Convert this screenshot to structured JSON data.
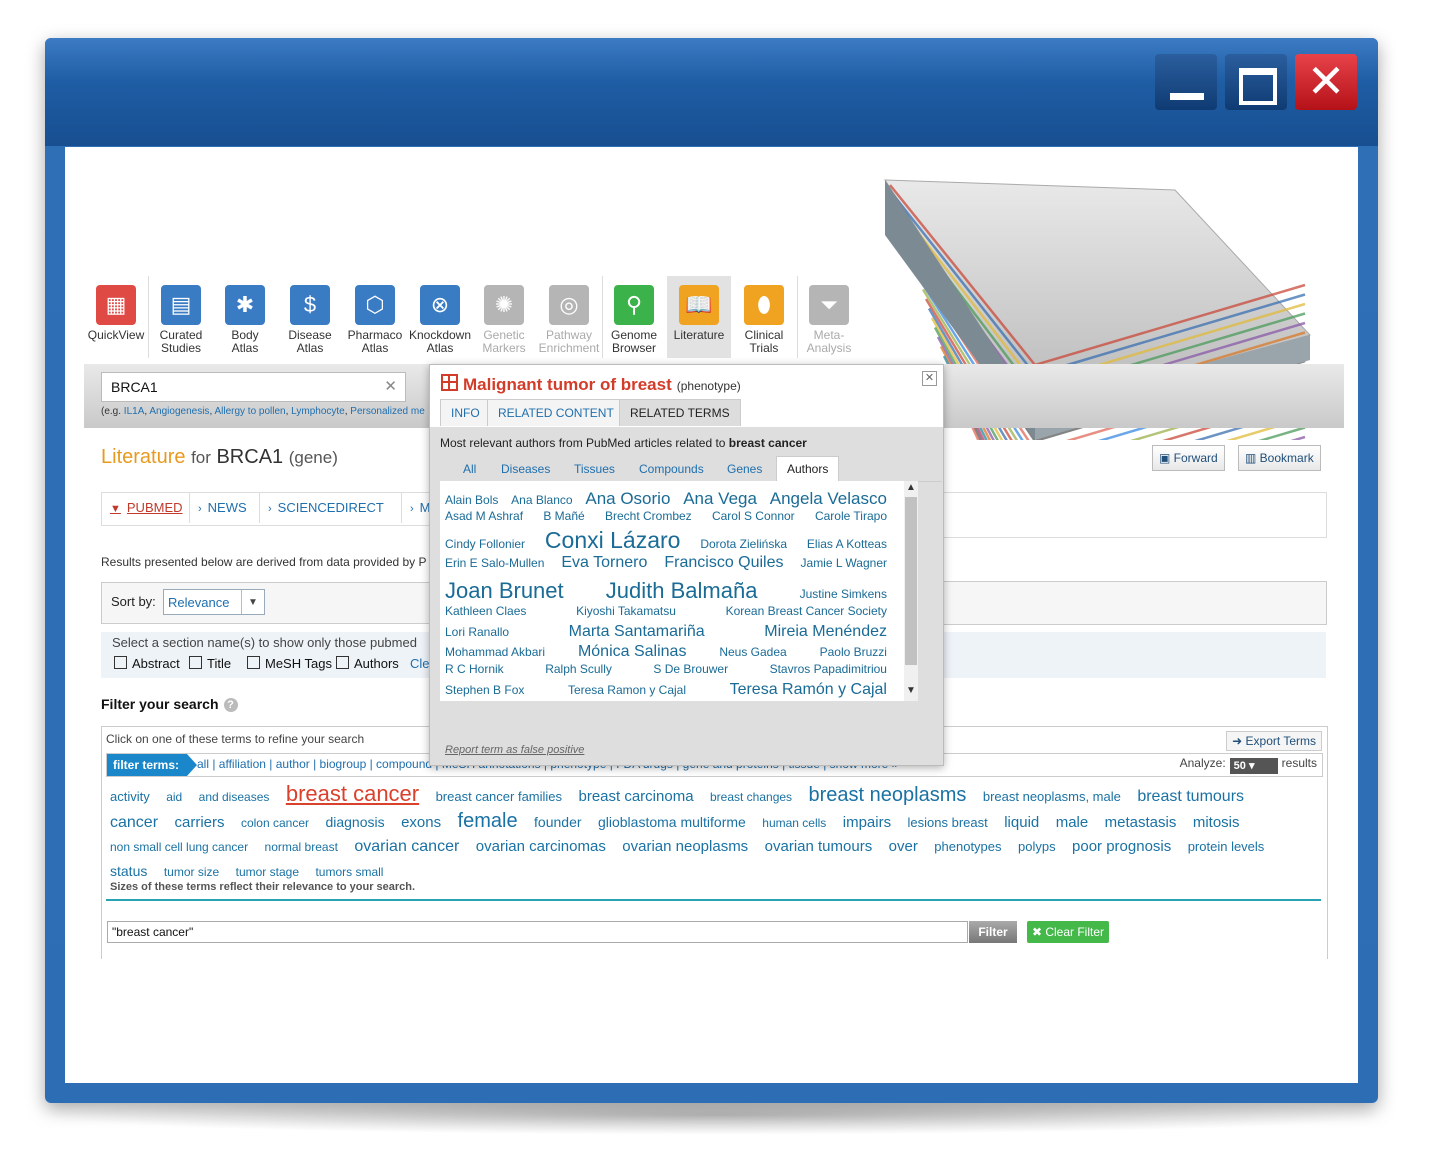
{
  "window": {
    "close_glyph": "✕"
  },
  "nav": [
    {
      "label1": "QuickView",
      "label2": "",
      "icon": "grid-icon",
      "glyph": "▦",
      "color": "#e04a45",
      "dim": false
    },
    {
      "label1": "Curated",
      "label2": "Studies",
      "icon": "folder-icon",
      "glyph": "▤",
      "color": "#3a7cc4",
      "dim": false
    },
    {
      "label1": "Body",
      "label2": "Atlas",
      "icon": "body-icon",
      "glyph": "✱",
      "color": "#3a7cc4",
      "dim": false
    },
    {
      "label1": "Disease",
      "label2": "Atlas",
      "icon": "dollar-icon",
      "glyph": "$",
      "color": "#3a7cc4",
      "dim": false
    },
    {
      "label1": "Pharmaco",
      "label2": "Atlas",
      "icon": "molecule-icon",
      "glyph": "⬡",
      "color": "#3a7cc4",
      "dim": false
    },
    {
      "label1": "Knockdown",
      "label2": "Atlas",
      "icon": "dna-icon",
      "glyph": "⊗",
      "color": "#3a7cc4",
      "dim": false
    },
    {
      "label1": "Genetic",
      "label2": "Markers",
      "icon": "virus-icon",
      "glyph": "✺",
      "color": "#b5b5b5",
      "dim": true
    },
    {
      "label1": "Pathway",
      "label2": "Enrichment",
      "icon": "circles-icon",
      "glyph": "◎",
      "color": "#b5b5b5",
      "dim": true
    },
    {
      "label1": "Genome",
      "label2": "Browser",
      "icon": "magnifier-dna-icon",
      "glyph": "⚲",
      "color": "#3bb34a",
      "dim": false
    },
    {
      "label1": "Literature",
      "label2": "",
      "icon": "book-icon",
      "glyph": "📖",
      "color": "#f0a321",
      "dim": false
    },
    {
      "label1": "Clinical",
      "label2": "Trials",
      "icon": "pill-icon",
      "glyph": "⬮",
      "color": "#f0a321",
      "dim": false
    },
    {
      "label1": "Meta-",
      "label2": "Analysis",
      "icon": "funnel-icon",
      "glyph": "⏷",
      "color": "#b5b5b5",
      "dim": true
    }
  ],
  "search": {
    "value": "BRCA1",
    "clear": "✕",
    "hint_prefix": "(e.g. ",
    "hint_links": [
      "IL1A",
      "Angiogenesis",
      "Allergy to pollen",
      "Lymphocyte",
      "Personalized me"
    ]
  },
  "main": {
    "title_lit": "Literature",
    "title_for": "for",
    "title_gene": "BRCA1",
    "title_type": "(gene)",
    "source_tabs": [
      "PUBMED",
      "NEWS",
      "SCIENCEDIRECT",
      "MA"
    ],
    "results_note": "Results presented below are derived from data provided by P",
    "sort_label": "Sort by:",
    "sort_value": "Relevance",
    "section_prompt": "Select a section name(s) to show only those pubmed",
    "section_checks": [
      "Abstract",
      "Title",
      "MeSH Tags",
      "Authors",
      "Cle"
    ],
    "forward": "Forward",
    "bookmark": "Bookmark"
  },
  "filter": {
    "title": "Filter your search",
    "hint": "Click on one of these terms to refine your search",
    "export": "Export Terms",
    "label": "filter terms:",
    "links": "all | affiliation | author | biogroup | compound | MeSH annotations | phenotype | FDA drugs | gene and proteins | tissue | show more »",
    "analyze_label": "Analyze:",
    "analyze_value": "50",
    "analyze_suffix": "results",
    "terms": [
      {
        "t": "activity",
        "s": 13
      },
      {
        "t": "aid",
        "s": 12
      },
      {
        "t": "and diseases",
        "s": 12
      },
      {
        "t": "breast cancer",
        "s": 22,
        "hot": true
      },
      {
        "t": "breast cancer families",
        "s": 13
      },
      {
        "t": "breast carcinoma",
        "s": 15
      },
      {
        "t": "breast changes",
        "s": 12
      },
      {
        "t": "breast neoplasms",
        "s": 20
      },
      {
        "t": "breast neoplasms, male",
        "s": 13
      },
      {
        "t": "breast tumours",
        "s": 16
      },
      {
        "t": "cancer",
        "s": 16
      },
      {
        "t": "carriers",
        "s": 15
      },
      {
        "t": "colon cancer",
        "s": 12
      },
      {
        "t": "diagnosis",
        "s": 14
      },
      {
        "t": "exons",
        "s": 15
      },
      {
        "t": "female",
        "s": 20
      },
      {
        "t": "founder",
        "s": 14
      },
      {
        "t": "glioblastoma multiforme",
        "s": 14
      },
      {
        "t": "human cells",
        "s": 12
      },
      {
        "t": "impairs",
        "s": 15
      },
      {
        "t": "lesions breast",
        "s": 13
      },
      {
        "t": "liquid",
        "s": 15
      },
      {
        "t": "male",
        "s": 15
      },
      {
        "t": "metastasis",
        "s": 15
      },
      {
        "t": "mitosis",
        "s": 15
      },
      {
        "t": "non small cell lung cancer",
        "s": 12
      },
      {
        "t": "normal breast",
        "s": 12
      },
      {
        "t": "ovarian cancer",
        "s": 16
      },
      {
        "t": "ovarian carcinomas",
        "s": 15
      },
      {
        "t": "ovarian neoplasms",
        "s": 15
      },
      {
        "t": "ovarian tumours",
        "s": 15
      },
      {
        "t": "over",
        "s": 15
      },
      {
        "t": "phenotypes",
        "s": 13
      },
      {
        "t": "polyps",
        "s": 13
      },
      {
        "t": "poor prognosis",
        "s": 15
      },
      {
        "t": "protein levels",
        "s": 13
      },
      {
        "t": "status",
        "s": 14
      },
      {
        "t": "tumor size",
        "s": 12
      },
      {
        "t": "tumor stage",
        "s": 12
      },
      {
        "t": "tumors small",
        "s": 12
      }
    ],
    "cloud_note": "Sizes of these terms reflect their relevance to your search.",
    "input_value": "\"breast cancer\"",
    "filter_btn": "Filter",
    "clear_btn": "✖ Clear Filter"
  },
  "popup": {
    "title": "Malignant tumor of breast",
    "type": "(phenotype)",
    "close": "✕",
    "tabs": [
      "INFO",
      "RELATED CONTENT",
      "RELATED TERMS"
    ],
    "sub_prefix": "Most relevant authors from PubMed articles related to ",
    "sub_term": "breast cancer",
    "author_tabs": [
      "All",
      "Diseases",
      "Tissues",
      "Compounds",
      "Genes",
      "Authors"
    ],
    "author_lines": [
      [
        {
          "t": "Alain Bols",
          "s": 12
        },
        {
          "t": "Ana Blanco",
          "s": 12
        },
        {
          "t": "Ana Osorio",
          "s": 17
        },
        {
          "t": "Ana Vega",
          "s": 17
        },
        {
          "t": "Angela Velasco",
          "s": 17
        }
      ],
      [
        {
          "t": "Asad M Ashraf",
          "s": 12
        },
        {
          "t": "B Mañé",
          "s": 12
        },
        {
          "t": "Brecht Crombez",
          "s": 12
        },
        {
          "t": "Carol S Connor",
          "s": 12
        },
        {
          "t": "Carole Tirapo",
          "s": 12
        }
      ],
      [
        {
          "t": "Cindy Follonier",
          "s": 12
        },
        {
          "t": "Conxi Lázaro",
          "s": 23
        },
        {
          "t": "Dorota Zielińska",
          "s": 12
        },
        {
          "t": "Elias A Kotteas",
          "s": 12
        }
      ],
      [
        {
          "t": "Erin E Salo-Mullen",
          "s": 12
        },
        {
          "t": "Eva Tornero",
          "s": 16
        },
        {
          "t": "Francisco Quiles",
          "s": 16
        },
        {
          "t": "Jamie L Wagner",
          "s": 12
        }
      ],
      [
        {
          "t": "Joan Brunet",
          "s": 22
        },
        {
          "t": "Judith Balmaña",
          "s": 22
        },
        {
          "t": "Justine Simkens",
          "s": 12
        }
      ],
      [
        {
          "t": "Kathleen Claes",
          "s": 12
        },
        {
          "t": "Kiyoshi Takamatsu",
          "s": 12
        },
        {
          "t": "Korean Breast Cancer Society",
          "s": 12
        }
      ],
      [
        {
          "t": "Lori Ranallo",
          "s": 12
        },
        {
          "t": "Marta Santamariña",
          "s": 16
        },
        {
          "t": "Mireia Menéndez",
          "s": 16
        }
      ],
      [
        {
          "t": "Mohammad Akbari",
          "s": 12
        },
        {
          "t": "Mónica Salinas",
          "s": 16
        },
        {
          "t": "Neus Gadea",
          "s": 12
        },
        {
          "t": "Paolo Bruzzi",
          "s": 12
        }
      ],
      [
        {
          "t": "R C Hornik",
          "s": 12
        },
        {
          "t": "Ralph Scully",
          "s": 12
        },
        {
          "t": "S De Brouwer",
          "s": 12
        },
        {
          "t": "Stavros Papadimitriou",
          "s": 12
        }
      ],
      [
        {
          "t": "Stephen B Fox",
          "s": 12
        },
        {
          "t": "Teresa Ramon y Cajal",
          "s": 12
        },
        {
          "t": "Teresa Ramón y Cajal",
          "s": 16
        }
      ]
    ],
    "report": "Report term as false positive"
  }
}
